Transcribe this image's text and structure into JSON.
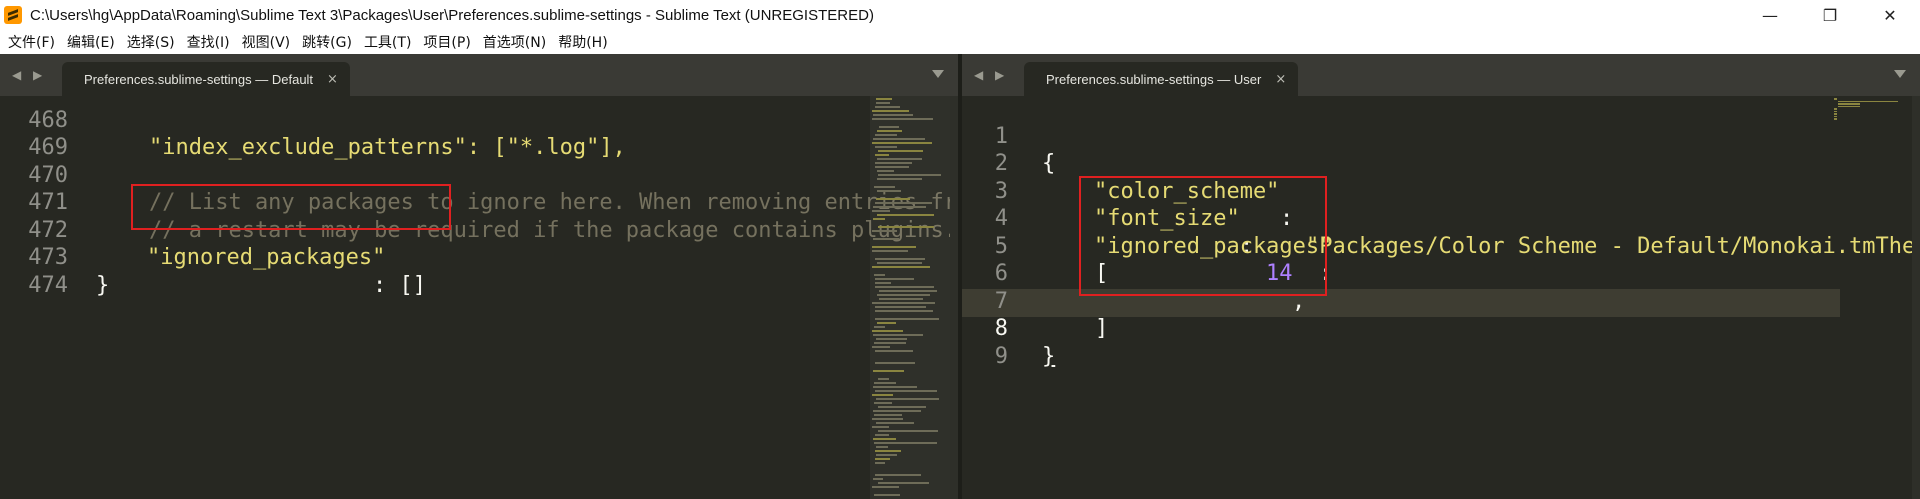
{
  "window": {
    "title": "C:\\Users\\hg\\AppData\\Roaming\\Sublime Text 3\\Packages\\User\\Preferences.sublime-settings - Sublime Text (UNREGISTERED)",
    "minimize_glyph": "—",
    "maximize_glyph": "❐",
    "close_glyph": "✕"
  },
  "menu": {
    "items": [
      "文件(F)",
      "编辑(E)",
      "选择(S)",
      "查找(I)",
      "视图(V)",
      "跳转(G)",
      "工具(T)",
      "项目(P)",
      "首选项(N)",
      "帮助(H)"
    ]
  },
  "left_pane": {
    "tab_label": "Preferences.sublime-settings — Default",
    "tab_close": "×",
    "nav_arrows": "◀ ▶",
    "lines": [
      {
        "num": "468",
        "text": "    \"index_exclude_patterns\": [\"*.log\"],",
        "cls": "str"
      },
      {
        "num": "469",
        "text": "",
        "cls": "pun"
      },
      {
        "num": "470",
        "text": "    // List any packages to ignore here. When removing entries from this list,",
        "cls": "com"
      },
      {
        "num": "471",
        "text": "    // a restart may be required if the package contains plugins.",
        "cls": "com"
      },
      {
        "num": "472",
        "key": "\"ignored_packages\"",
        "rest": ": []"
      },
      {
        "num": "473",
        "text": "}",
        "cls": "pun"
      },
      {
        "num": "474",
        "text": "",
        "cls": "pun"
      }
    ]
  },
  "right_pane": {
    "tab_label": "Preferences.sublime-settings — User",
    "tab_close": "×",
    "nav_arrows": "◀ ▶",
    "lines": [
      {
        "num": "1",
        "text": "{"
      },
      {
        "num": "2",
        "key": "\"color_scheme\"",
        "sep": ": ",
        "val": "\"Packages/Color Scheme - Default/Monokai.tmTheme\"",
        "tail": ","
      },
      {
        "num": "3",
        "key": "\"font_size\"",
        "sep": ": ",
        "num_val": "14",
        "tail": ","
      },
      {
        "num": "4",
        "key": "\"ignored_packages\"",
        "sep": ":",
        "tail": ""
      },
      {
        "num": "5",
        "text": "    ["
      },
      {
        "num": "6",
        "text": ""
      },
      {
        "num": "7",
        "text": "    ]"
      },
      {
        "num": "8",
        "text": "}"
      },
      {
        "num": "9",
        "text": ""
      }
    ],
    "current_line": "8"
  },
  "colors": {
    "background": "#272822",
    "string": "#e6db74",
    "number": "#ae81ff",
    "comment": "#75715e",
    "highlight_box": "#e02020"
  }
}
